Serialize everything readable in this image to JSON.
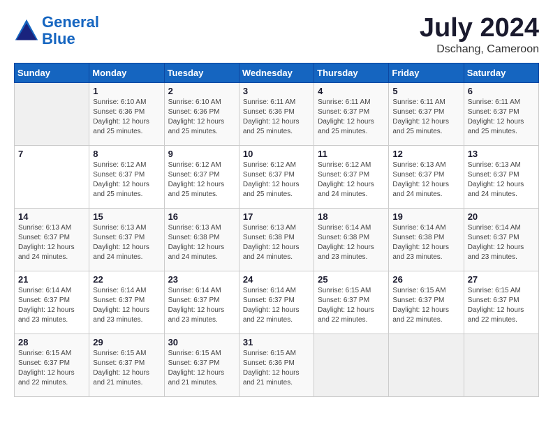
{
  "logo": {
    "line1": "General",
    "line2": "Blue"
  },
  "title": "July 2024",
  "location": "Dschang, Cameroon",
  "header_days": [
    "Sunday",
    "Monday",
    "Tuesday",
    "Wednesday",
    "Thursday",
    "Friday",
    "Saturday"
  ],
  "weeks": [
    [
      {
        "day": "",
        "info": ""
      },
      {
        "day": "1",
        "info": "Sunrise: 6:10 AM\nSunset: 6:36 PM\nDaylight: 12 hours\nand 25 minutes."
      },
      {
        "day": "2",
        "info": "Sunrise: 6:10 AM\nSunset: 6:36 PM\nDaylight: 12 hours\nand 25 minutes."
      },
      {
        "day": "3",
        "info": "Sunrise: 6:11 AM\nSunset: 6:36 PM\nDaylight: 12 hours\nand 25 minutes."
      },
      {
        "day": "4",
        "info": "Sunrise: 6:11 AM\nSunset: 6:37 PM\nDaylight: 12 hours\nand 25 minutes."
      },
      {
        "day": "5",
        "info": "Sunrise: 6:11 AM\nSunset: 6:37 PM\nDaylight: 12 hours\nand 25 minutes."
      },
      {
        "day": "6",
        "info": "Sunrise: 6:11 AM\nSunset: 6:37 PM\nDaylight: 12 hours\nand 25 minutes."
      }
    ],
    [
      {
        "day": "7",
        "info": ""
      },
      {
        "day": "8",
        "info": "Sunrise: 6:12 AM\nSunset: 6:37 PM\nDaylight: 12 hours\nand 25 minutes."
      },
      {
        "day": "9",
        "info": "Sunrise: 6:12 AM\nSunset: 6:37 PM\nDaylight: 12 hours\nand 25 minutes."
      },
      {
        "day": "10",
        "info": "Sunrise: 6:12 AM\nSunset: 6:37 PM\nDaylight: 12 hours\nand 25 minutes."
      },
      {
        "day": "11",
        "info": "Sunrise: 6:12 AM\nSunset: 6:37 PM\nDaylight: 12 hours\nand 24 minutes."
      },
      {
        "day": "12",
        "info": "Sunrise: 6:13 AM\nSunset: 6:37 PM\nDaylight: 12 hours\nand 24 minutes."
      },
      {
        "day": "13",
        "info": "Sunrise: 6:13 AM\nSunset: 6:37 PM\nDaylight: 12 hours\nand 24 minutes."
      }
    ],
    [
      {
        "day": "14",
        "info": "Sunrise: 6:13 AM\nSunset: 6:37 PM\nDaylight: 12 hours\nand 24 minutes."
      },
      {
        "day": "15",
        "info": "Sunrise: 6:13 AM\nSunset: 6:37 PM\nDaylight: 12 hours\nand 24 minutes."
      },
      {
        "day": "16",
        "info": "Sunrise: 6:13 AM\nSunset: 6:38 PM\nDaylight: 12 hours\nand 24 minutes."
      },
      {
        "day": "17",
        "info": "Sunrise: 6:13 AM\nSunset: 6:38 PM\nDaylight: 12 hours\nand 24 minutes."
      },
      {
        "day": "18",
        "info": "Sunrise: 6:14 AM\nSunset: 6:38 PM\nDaylight: 12 hours\nand 23 minutes."
      },
      {
        "day": "19",
        "info": "Sunrise: 6:14 AM\nSunset: 6:38 PM\nDaylight: 12 hours\nand 23 minutes."
      },
      {
        "day": "20",
        "info": "Sunrise: 6:14 AM\nSunset: 6:37 PM\nDaylight: 12 hours\nand 23 minutes."
      }
    ],
    [
      {
        "day": "21",
        "info": "Sunrise: 6:14 AM\nSunset: 6:37 PM\nDaylight: 12 hours\nand 23 minutes."
      },
      {
        "day": "22",
        "info": "Sunrise: 6:14 AM\nSunset: 6:37 PM\nDaylight: 12 hours\nand 23 minutes."
      },
      {
        "day": "23",
        "info": "Sunrise: 6:14 AM\nSunset: 6:37 PM\nDaylight: 12 hours\nand 23 minutes."
      },
      {
        "day": "24",
        "info": "Sunrise: 6:14 AM\nSunset: 6:37 PM\nDaylight: 12 hours\nand 22 minutes."
      },
      {
        "day": "25",
        "info": "Sunrise: 6:15 AM\nSunset: 6:37 PM\nDaylight: 12 hours\nand 22 minutes."
      },
      {
        "day": "26",
        "info": "Sunrise: 6:15 AM\nSunset: 6:37 PM\nDaylight: 12 hours\nand 22 minutes."
      },
      {
        "day": "27",
        "info": "Sunrise: 6:15 AM\nSunset: 6:37 PM\nDaylight: 12 hours\nand 22 minutes."
      }
    ],
    [
      {
        "day": "28",
        "info": "Sunrise: 6:15 AM\nSunset: 6:37 PM\nDaylight: 12 hours\nand 22 minutes."
      },
      {
        "day": "29",
        "info": "Sunrise: 6:15 AM\nSunset: 6:37 PM\nDaylight: 12 hours\nand 21 minutes."
      },
      {
        "day": "30",
        "info": "Sunrise: 6:15 AM\nSunset: 6:37 PM\nDaylight: 12 hours\nand 21 minutes."
      },
      {
        "day": "31",
        "info": "Sunrise: 6:15 AM\nSunset: 6:36 PM\nDaylight: 12 hours\nand 21 minutes."
      },
      {
        "day": "",
        "info": ""
      },
      {
        "day": "",
        "info": ""
      },
      {
        "day": "",
        "info": ""
      }
    ]
  ]
}
